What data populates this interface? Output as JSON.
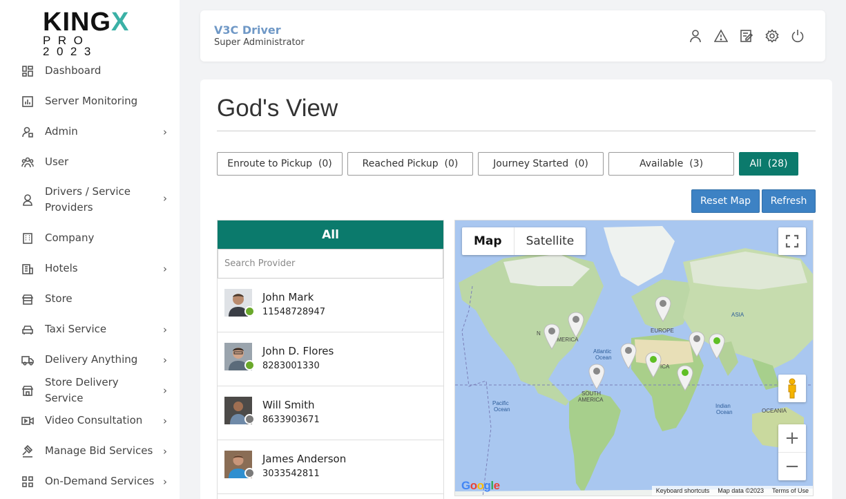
{
  "logo": {
    "main_prefix": "KING",
    "main_accent": "X",
    "sub": "PRO 2023",
    "accent_color": "#3bb1a6"
  },
  "sidebar": {
    "items": [
      {
        "label": "Dashboard",
        "icon": "dashboard-icon",
        "has_submenu": false
      },
      {
        "label": "Server Monitoring",
        "icon": "server-monitoring-icon",
        "has_submenu": false
      },
      {
        "label": "Admin",
        "icon": "admin-icon",
        "has_submenu": true
      },
      {
        "label": "User",
        "icon": "user-group-icon",
        "has_submenu": false
      },
      {
        "label": "Drivers / Service Providers",
        "icon": "driver-icon",
        "has_submenu": true
      },
      {
        "label": "Company",
        "icon": "company-icon",
        "has_submenu": false
      },
      {
        "label": "Hotels",
        "icon": "hotel-icon",
        "has_submenu": true
      },
      {
        "label": "Store",
        "icon": "store-icon",
        "has_submenu": false
      },
      {
        "label": "Taxi Service",
        "icon": "taxi-icon",
        "has_submenu": true
      },
      {
        "label": "Delivery Anything",
        "icon": "truck-icon",
        "has_submenu": true
      },
      {
        "label": "Store Delivery Service",
        "icon": "store-delivery-icon",
        "has_submenu": true
      },
      {
        "label": "Video Consultation",
        "icon": "video-icon",
        "has_submenu": true
      },
      {
        "label": "Manage Bid Services",
        "icon": "gavel-icon",
        "has_submenu": true
      },
      {
        "label": "On-Demand Services",
        "icon": "grid-icon",
        "has_submenu": true
      }
    ],
    "chevron": "›"
  },
  "header": {
    "title": "V3C Driver",
    "subtitle": "Super Administrator",
    "icons": [
      "profile-icon",
      "alert-icon",
      "edit-icon",
      "settings-icon",
      "power-icon"
    ]
  },
  "main": {
    "title": "God's View",
    "filters": [
      {
        "label": "Enroute to Pickup  (0)",
        "active": false
      },
      {
        "label": "Reached Pickup  (0)",
        "active": false
      },
      {
        "label": "Journey Started  (0)",
        "active": false
      },
      {
        "label": "Available  (3)",
        "active": false
      },
      {
        "label": "All  (28)",
        "active": true
      }
    ],
    "reset_map_label": "Reset Map",
    "refresh_label": "Refresh"
  },
  "provider_list": {
    "header": "All",
    "search_placeholder": "Search Provider",
    "providers": [
      {
        "name": "John Mark",
        "phone": "11548728947",
        "status_color": "#6aa82b"
      },
      {
        "name": "John D. Flores",
        "phone": "8283001330",
        "status_color": "#6aa82b"
      },
      {
        "name": "Will Smith",
        "phone": "8633903671",
        "status_color": "#7a7a7a"
      },
      {
        "name": "James Anderson",
        "phone": "3033542811",
        "status_color": "#7a7a7a"
      }
    ]
  },
  "map": {
    "type_map": "Map",
    "type_satellite": "Satellite",
    "labels": {
      "asia": "ASIA",
      "europe": "EUROPE",
      "north_america_a": "N",
      "north_america_b": "AMERICA",
      "africa": "ICA",
      "south_america_a": "SOUTH",
      "south_america_b": "AMERICA",
      "oceania": "OCEANIA",
      "atlantic_a": "Atlantic",
      "atlantic_b": "Ocean",
      "pacific_a": "Pacific",
      "pacific_b": "Ocean",
      "indian_a": "Indian",
      "indian_b": "Ocean"
    },
    "footer": {
      "shortcuts": "Keyboard shortcuts",
      "data": "Map data ©2023",
      "terms": "Terms of Use"
    },
    "google": "Google",
    "zoom_in": "+",
    "zoom_out": "−",
    "marker_colors": {
      "online": "#5fbf25",
      "offline": "#8a8a8a"
    }
  }
}
